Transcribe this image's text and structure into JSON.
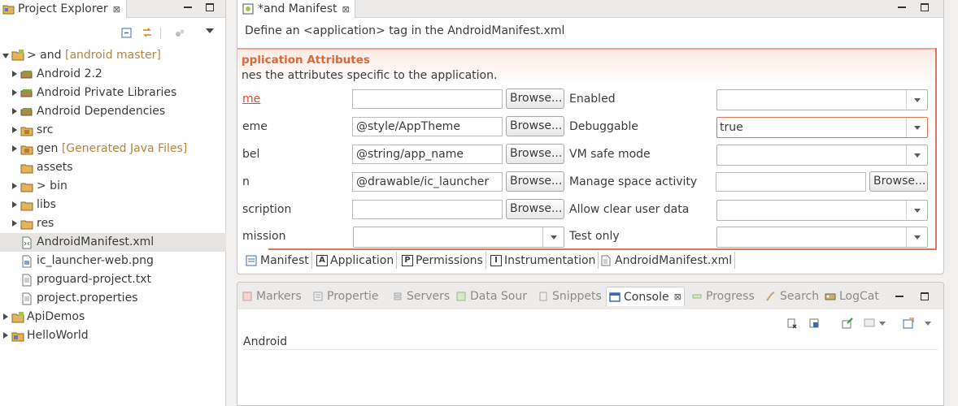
{
  "explorer": {
    "tab_label": "Project Explorer",
    "tab_close": "⊠",
    "tree": [
      {
        "label": "> and",
        "deco": "[android master]"
      },
      {
        "label": "Android 2.2",
        "deco": ""
      },
      {
        "label": "Android Private Libraries",
        "deco": ""
      },
      {
        "label": "Android Dependencies",
        "deco": ""
      },
      {
        "label": "src",
        "deco": ""
      },
      {
        "label": "gen",
        "deco": "[Generated Java Files]"
      },
      {
        "label": "assets",
        "deco": ""
      },
      {
        "label": "> bin",
        "deco": ""
      },
      {
        "label": "libs",
        "deco": ""
      },
      {
        "label": "res",
        "deco": ""
      },
      {
        "label": "AndroidManifest.xml",
        "deco": ""
      },
      {
        "label": "ic_launcher-web.png",
        "deco": ""
      },
      {
        "label": "proguard-project.txt",
        "deco": ""
      },
      {
        "label": "project.properties",
        "deco": ""
      },
      {
        "label": "ApiDemos",
        "deco": ""
      },
      {
        "label": "HelloWorld",
        "deco": ""
      }
    ]
  },
  "editor": {
    "tab_label": "*and Manifest",
    "tab_close": "⊠",
    "description": "Define an <application> tag in the AndroidManifest.xml",
    "section_title": "pplication Attributes",
    "section_sub": "nes the attributes specific to the application.",
    "left_fields": [
      {
        "label": "me",
        "value": "",
        "button": "Browse..."
      },
      {
        "label": "eme",
        "value": "@style/AppTheme",
        "button": "Browse..."
      },
      {
        "label": "bel",
        "value": "@string/app_name",
        "button": "Browse..."
      },
      {
        "label": "n",
        "value": "@drawable/ic_launcher",
        "button": "Browse..."
      },
      {
        "label": "scription",
        "value": "",
        "button": "Browse..."
      },
      {
        "label": "mission",
        "value": ""
      }
    ],
    "right_fields": [
      {
        "label": "Enabled",
        "value": ""
      },
      {
        "label": "Debuggable",
        "value": "true"
      },
      {
        "label": "VM safe mode",
        "value": ""
      },
      {
        "label": "Manage space activity",
        "value": "",
        "button": "Browse..."
      },
      {
        "label": "Allow clear user data",
        "value": ""
      },
      {
        "label": "Test only",
        "value": ""
      }
    ],
    "page_tabs": [
      {
        "label": "Manifest",
        "icon": "manifest-icon",
        "glyph": ""
      },
      {
        "label": "Application",
        "icon": "application-icon",
        "glyph": "A"
      },
      {
        "label": "Permissions",
        "icon": "permissions-icon",
        "glyph": "P"
      },
      {
        "label": "Instrumentation",
        "icon": "instrumentation-icon",
        "glyph": "I"
      },
      {
        "label": "AndroidManifest.xml",
        "icon": "xml-file-icon",
        "glyph": ""
      }
    ]
  },
  "console": {
    "tabs": [
      {
        "label": "Markers"
      },
      {
        "label": "Propertie"
      },
      {
        "label": "Servers"
      },
      {
        "label": "Data Sour"
      },
      {
        "label": "Snippets"
      },
      {
        "label": "Console",
        "close": "⊠"
      },
      {
        "label": "Progress"
      },
      {
        "label": "Search"
      },
      {
        "label": "LogCat"
      }
    ],
    "content_label": "Android"
  },
  "colors": {
    "accent": "#d86a3a",
    "link": "#e04a1c",
    "section_border": "#d9775a",
    "decoration": "#b8843f"
  }
}
